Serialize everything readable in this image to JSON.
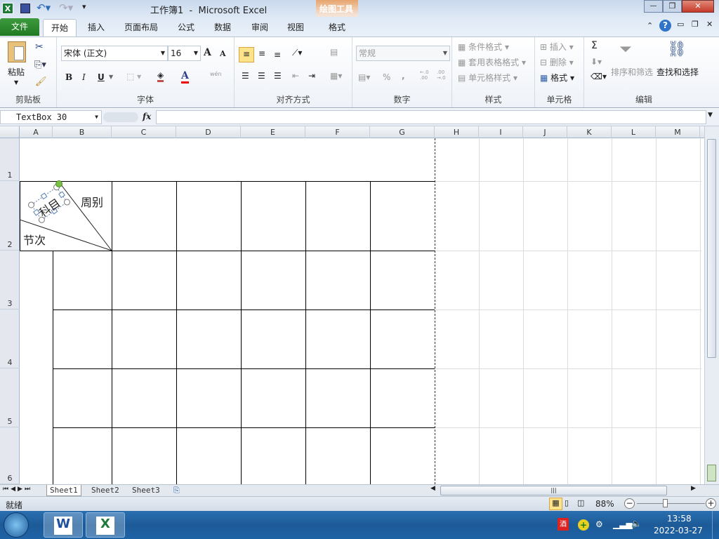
{
  "title_bar": {
    "title": "工作簿1  -  Microsoft Excel",
    "contextual_tab_group": "绘图工具",
    "minimize": "—",
    "restore": "❐",
    "close": "✕"
  },
  "tabs": {
    "file": "文件",
    "items": [
      "开始",
      "插入",
      "页面布局",
      "公式",
      "数据",
      "审阅",
      "视图"
    ],
    "contextual": "格式"
  },
  "ribbon": {
    "clipboard": {
      "paste": "粘贴",
      "label": "剪贴板"
    },
    "font": {
      "name": "宋体 (正文)",
      "size": "16",
      "bold": "B",
      "italic": "I",
      "underline": "U",
      "grow": "A",
      "shrink": "A",
      "font_color": "A",
      "phonetic": "wén",
      "label": "字体"
    },
    "alignment": {
      "label": "对齐方式"
    },
    "number": {
      "format": "常规",
      "percent": "%",
      "comma": ",",
      "inc_decimal": "←.0 .00",
      "dec_decimal": ".00 →.0",
      "label": "数字"
    },
    "styles": {
      "conditional": "条件格式",
      "table": "套用表格格式",
      "cell_styles": "单元格样式",
      "label": "样式"
    },
    "cells": {
      "insert": "插入",
      "delete": "删除",
      "format": "格式",
      "label": "单元格"
    },
    "editing": {
      "sum": "Σ",
      "sort": "排序和筛选",
      "find": "查找和选择",
      "label": "编辑"
    }
  },
  "formula_bar": {
    "name_box": "TextBox 30",
    "fx": "fx",
    "value": ""
  },
  "columns": [
    "A",
    "B",
    "C",
    "D",
    "E",
    "F",
    "G",
    "H",
    "I",
    "J",
    "K",
    "L",
    "M"
  ],
  "rows": [
    "1",
    "2",
    "3",
    "4",
    "5",
    "6"
  ],
  "cells": {
    "diag_top": "周别",
    "diag_mid": "科目",
    "diag_bottom": "节次"
  },
  "sheets": [
    "Sheet1",
    "Sheet2",
    "Sheet3"
  ],
  "status": {
    "ready": "就绪",
    "zoom": "88%"
  },
  "taskbar": {
    "time": "13:58",
    "date": "2022-03-27",
    "apps": [
      "W",
      "X"
    ]
  },
  "colors": {
    "file_tab": "#2a8a2e",
    "accent": "#1d5a98",
    "handle": "#7ac143"
  }
}
